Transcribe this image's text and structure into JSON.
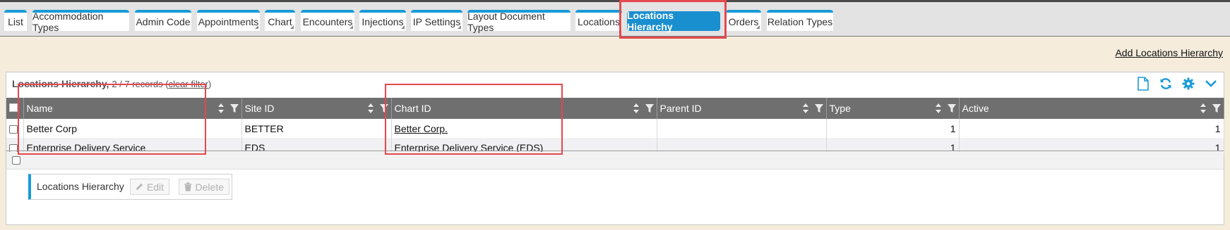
{
  "tabs": [
    {
      "label": "List",
      "corner": false
    },
    {
      "label": "Accommodation Types",
      "corner": false
    },
    {
      "label": "Admin Code",
      "corner": false
    },
    {
      "label": "Appointments",
      "corner": true
    },
    {
      "label": "Chart",
      "corner": true
    },
    {
      "label": "Encounters",
      "corner": true
    },
    {
      "label": "Injections",
      "corner": true
    },
    {
      "label": "IP Settings",
      "corner": true
    },
    {
      "label": "Layout Document Types",
      "corner": false
    },
    {
      "label": "Locations",
      "corner": false
    },
    {
      "label": "Locations Hierarchy",
      "corner": false,
      "active": true
    },
    {
      "label": "Orders",
      "corner": true
    },
    {
      "label": "Relation Types",
      "corner": false
    }
  ],
  "add_link": "Add Locations Hierarchy",
  "panel": {
    "title": "Locations Hierarchy,",
    "records": "2 / 7 records",
    "clear_filter": "clear filter"
  },
  "columns": [
    "Name",
    "Site ID",
    "Chart ID",
    "Parent ID",
    "Type",
    "Active"
  ],
  "rows": [
    {
      "name": "Better Corp",
      "site_id": "BETTER",
      "chart_id": "Better Corp.",
      "parent_id": "",
      "type": "1",
      "active": "1"
    },
    {
      "name": "Enterprise Delivery Service",
      "site_id": "EDS",
      "chart_id": "Enterprise Delivery Service (EDS)",
      "parent_id": "",
      "type": "1",
      "active": "1"
    }
  ],
  "actionbar": {
    "label": "Locations Hierarchy",
    "edit": "Edit",
    "delete": "Delete"
  },
  "colors": {
    "accent": "#1a9ad6",
    "header_bg": "#6f6f6f",
    "highlight": "#e5484d",
    "page_bg": "#f5ecdc"
  }
}
